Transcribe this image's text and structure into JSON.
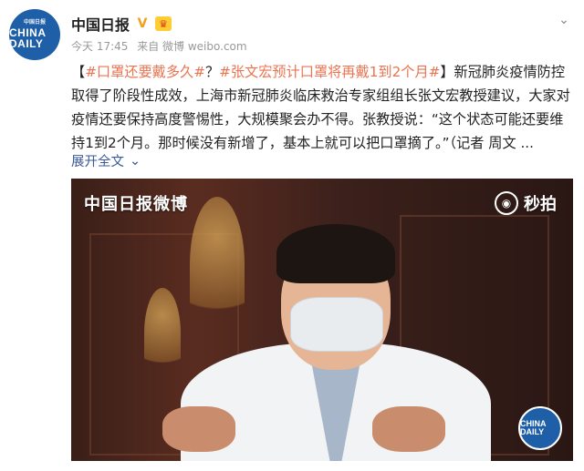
{
  "account": {
    "avatar_top": "中国日报",
    "avatar_main": "CHINA DAILY",
    "name": "中国日报",
    "verified_icon": "verified-v-icon",
    "badge_icon": "member-crown-icon"
  },
  "meta": {
    "time": "今天 17:45",
    "source": "来自 微博 weibo.com"
  },
  "post": {
    "bracket_open": "【",
    "hashtag1": "#口罩还要戴多久#",
    "question": "？",
    "hashtag2": "#张文宏预计口罩将再戴1到2个月#",
    "bracket_close": "】",
    "body": "新冠肺炎疫情防控取得了阶段性成效，上海市新冠肺炎临床救治专家组组长张文宏教授建议，大家对疫情还要保持高度警惕性，大规模聚会办不得。张教授说：“这个状态可能还要维持1到2个月。那时候没有新增了，基本上就可以把口罩摘了。”（记者 周文 ...",
    "expand_label": "展开全文"
  },
  "video": {
    "watermark_left": "中国日报微博",
    "watermark_right": "秒拍",
    "corner_logo": "CHINA DAILY"
  },
  "colors": {
    "hashtag": "#eb7350",
    "link": "#3b5998",
    "brand_blue": "#1f5fa8"
  }
}
